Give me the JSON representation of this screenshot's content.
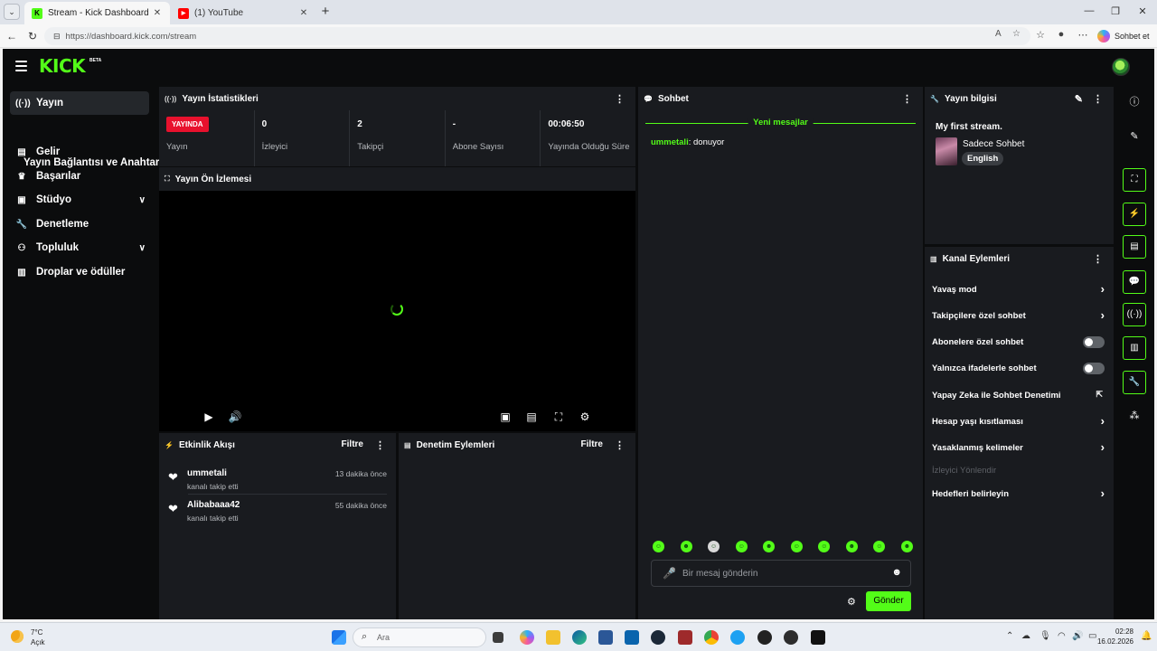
{
  "browser": {
    "tabs": [
      {
        "title": "Stream - Kick Dashboard",
        "active": true
      },
      {
        "title": "(1) YouTube",
        "active": false
      }
    ],
    "url": "https://dashboard.kick.com/stream",
    "copilot_label": "Sohbet et"
  },
  "app": {
    "logo": "KICK",
    "logo_badge": "BETA",
    "colors": {
      "accent": "#53fc18",
      "live": "#e8112d",
      "panel": "#191b1f",
      "background": "#0b0c0d"
    }
  },
  "sidebar": {
    "items": [
      {
        "label": "Yayın",
        "icon": "broadcast-icon"
      },
      {
        "label": "Yayın Bağlantısı ve Anahtarı",
        "icon": ""
      },
      {
        "label": "Gelir",
        "icon": "chart-icon"
      },
      {
        "label": "Başarılar",
        "icon": "trophy-icon"
      },
      {
        "label": "Stüdyo",
        "icon": "studio-icon"
      },
      {
        "label": "Denetleme",
        "icon": "wrench-icon"
      },
      {
        "label": "Topluluk",
        "icon": "community-icon"
      },
      {
        "label": "Droplar ve ödüller",
        "icon": "gift-icon"
      }
    ]
  },
  "stats_panel": {
    "title": "Yayın İstatistikleri",
    "live_badge": "YAYINDA",
    "stats": [
      {
        "value": "",
        "label": "Yayın"
      },
      {
        "value": "0",
        "label": "İzleyici"
      },
      {
        "value": "2",
        "label": "Takipçi"
      },
      {
        "value": "-",
        "label": "Abone Sayısı"
      },
      {
        "value": "00:06:50",
        "label": "Yayında Olduğu Süre"
      }
    ]
  },
  "preview_panel": {
    "title": "Yayın Ön İzlemesi"
  },
  "activity_panel": {
    "title": "Etkinlik Akışı",
    "filter": "Filtre",
    "items": [
      {
        "name": "ummetali",
        "action": "kanalı takip etti",
        "time": "13 dakika önce"
      },
      {
        "name": "Alibabaaa42",
        "action": "kanalı takip etti",
        "time": "55 dakika önce"
      }
    ]
  },
  "moderation_panel": {
    "title": "Denetim Eylemleri",
    "filter": "Filtre"
  },
  "chat_panel": {
    "title": "Sohbet",
    "new_messages": "Yeni mesajlar",
    "messages": [
      {
        "user": "ummetali",
        "text": "donuyor"
      }
    ],
    "input_placeholder": "Bir mesaj gönderin",
    "send_label": "Gönder"
  },
  "stream_info": {
    "title": "Yayın bilgisi",
    "stream_title": "My first stream.",
    "category": "Sadece Sohbet",
    "tag": "English"
  },
  "channel_actions": {
    "title": "Kanal Eylemleri",
    "items": [
      {
        "label": "Yavaş mod",
        "control": "arrow"
      },
      {
        "label": "Takipçilere özel sohbet",
        "control": "arrow"
      },
      {
        "label": "Abonelere özel sohbet",
        "control": "toggle",
        "on": false
      },
      {
        "label": "Yalnızca ifadelerle sohbet",
        "control": "toggle",
        "on": false
      },
      {
        "label": "Yapay Zeka ile Sohbet Denetimi",
        "control": "external"
      },
      {
        "label": "Hesap yaşı kısıtlaması",
        "control": "arrow"
      },
      {
        "label": "Yasaklanmış kelimeler",
        "control": "arrow"
      },
      {
        "label": "İzleyici Yönlendir",
        "control": "none",
        "disabled": true
      },
      {
        "label": "Hedefleri belirleyin",
        "control": "arrow"
      }
    ]
  },
  "taskbar": {
    "weather_temp": "7°C",
    "weather_desc": "Açık",
    "search_placeholder": "Ara",
    "time": "02:28",
    "date": "16.02.2026"
  }
}
